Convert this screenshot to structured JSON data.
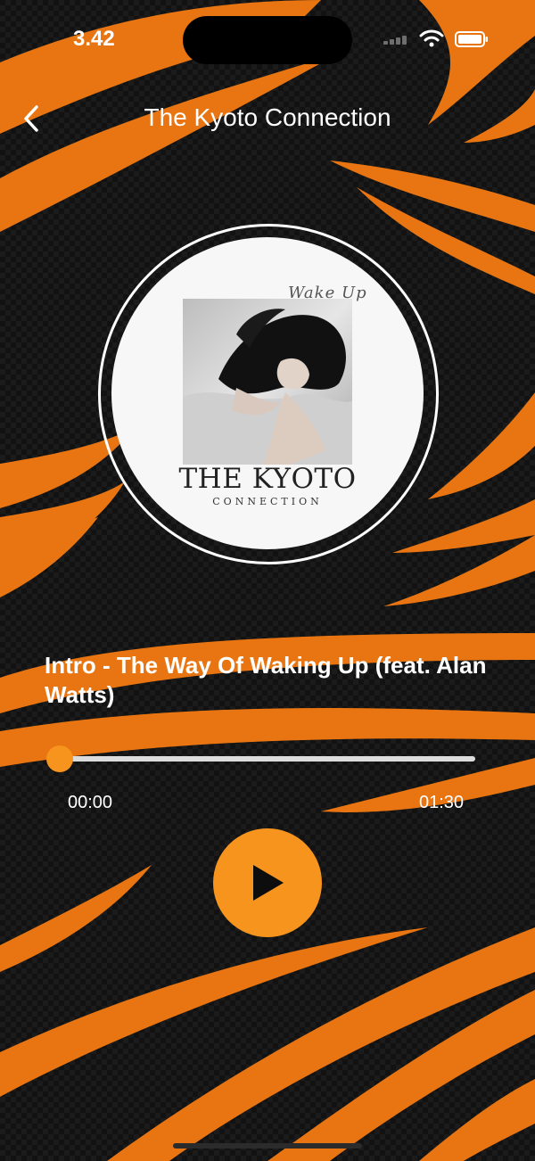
{
  "status_bar": {
    "time": "3.42"
  },
  "nav": {
    "title": "The Kyoto Connection",
    "back_icon": "chevron-left-icon"
  },
  "artwork": {
    "sticker": "Wake Up",
    "brand": "THE KYOTO",
    "subtitle": "CONNECTION"
  },
  "track": {
    "title": "Intro - The Way Of Waking Up (feat. Alan Watts)"
  },
  "player": {
    "elapsed": "00:00",
    "duration": "01:30",
    "progress": 0.0,
    "play_icon": "play-icon"
  },
  "colors": {
    "accent": "#f7941d",
    "background": "#121212",
    "text": "#ffffff"
  }
}
